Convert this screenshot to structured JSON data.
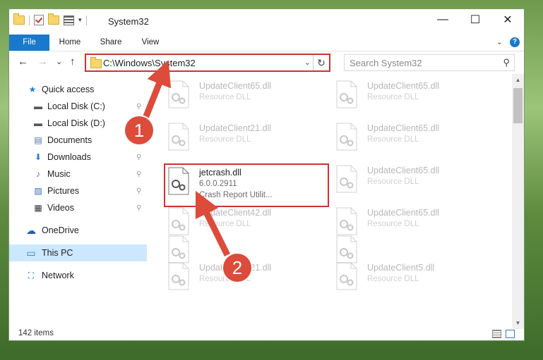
{
  "window": {
    "title": "System32",
    "qat_dropdown": "▾",
    "controls": {
      "minimize": "—",
      "maximize": "☐",
      "close": "✕"
    }
  },
  "ribbon": {
    "tabs": [
      "File",
      "Home",
      "Share",
      "View"
    ],
    "expand": "⌄",
    "help": "?"
  },
  "nav": {
    "back": "←",
    "forward": "→",
    "recent": "⌄",
    "up": "↑",
    "address": "C:\\Windows\\System32",
    "address_dropdown": "⌄",
    "refresh": "↻",
    "search_placeholder": "Search System32",
    "search_icon": "⚲"
  },
  "sidebar": {
    "items": [
      {
        "label": "Quick access",
        "icon": "star-icon",
        "glyph": "★",
        "color": "#2b7cd3",
        "pinned": false
      },
      {
        "label": "Local Disk (C:)",
        "icon": "drive-icon",
        "glyph": "▬",
        "color": "#555555",
        "pinned": true
      },
      {
        "label": "Local Disk (D:)",
        "icon": "drive-icon",
        "glyph": "▬",
        "color": "#555555",
        "pinned": true
      },
      {
        "label": "Documents",
        "icon": "documents-icon",
        "glyph": "▤",
        "color": "#4a6fa5",
        "pinned": true
      },
      {
        "label": "Downloads",
        "icon": "download-icon",
        "glyph": "⬇",
        "color": "#2b7cd3",
        "pinned": true
      },
      {
        "label": "Music",
        "icon": "music-icon",
        "glyph": "♪",
        "color": "#2b7cd3",
        "pinned": true
      },
      {
        "label": "Pictures",
        "icon": "pictures-icon",
        "glyph": "▨",
        "color": "#3b6ea8",
        "pinned": true
      },
      {
        "label": "Videos",
        "icon": "videos-icon",
        "glyph": "▦",
        "color": "#333333",
        "pinned": true
      },
      {
        "label": "OneDrive",
        "icon": "cloud-icon",
        "glyph": "☁",
        "color": "#1f5fb4",
        "pinned": false
      },
      {
        "label": "This PC",
        "icon": "pc-icon",
        "glyph": "▭",
        "color": "#2b7cd3",
        "pinned": false,
        "selected": true
      },
      {
        "label": "Network",
        "icon": "network-icon",
        "glyph": "⛶",
        "color": "#2b7cd3",
        "pinned": false
      }
    ],
    "pin_glyph": "📌"
  },
  "files": [
    {
      "name": "UpdateClient65.dll",
      "desc1": "Resource DLL",
      "desc2": "",
      "faded": true
    },
    {
      "name": "UpdateClient65.dll",
      "desc1": "Resource DLL",
      "desc2": "",
      "faded": true
    },
    {
      "name": "UpdateClient21.dll",
      "desc1": "Resource DLL",
      "desc2": "",
      "faded": true
    },
    {
      "name": "UpdateClient65.dll",
      "desc1": "Resource DLL",
      "desc2": "",
      "faded": true
    },
    {
      "name": "jetcrash.dll",
      "desc1": "6.0.0.2911",
      "desc2": "Crash Report Utilit...",
      "faded": false,
      "highlighted": true
    },
    {
      "name": "UpdateClient65.dll",
      "desc1": "Resource DLL",
      "desc2": "",
      "faded": true
    },
    {
      "name": "UpdateClient42.dll",
      "desc1": "Resource DLL",
      "desc2": "",
      "faded": true
    },
    {
      "name": "UpdateClient65.dll",
      "desc1": "Resource DLL",
      "desc2": "",
      "faded": true
    },
    {
      "name": "",
      "desc1": "",
      "desc2": "",
      "faded": true
    },
    {
      "name": "",
      "desc1": "",
      "desc2": "",
      "faded": true
    },
    {
      "name": "UpdateClient21.dll",
      "desc1": "Resource DLL",
      "desc2": "",
      "faded": true
    },
    {
      "name": "UpdateClient5.dll",
      "desc1": "Resource DLL",
      "desc2": "",
      "faded": true
    }
  ],
  "status": {
    "item_count": "142 items"
  },
  "annotations": {
    "step1": "1",
    "step2": "2",
    "accent": "#dd4b3a",
    "highlight": "#d32f2f"
  },
  "colors": {
    "file_tab": "#1979ca",
    "selection": "#cce8ff"
  }
}
